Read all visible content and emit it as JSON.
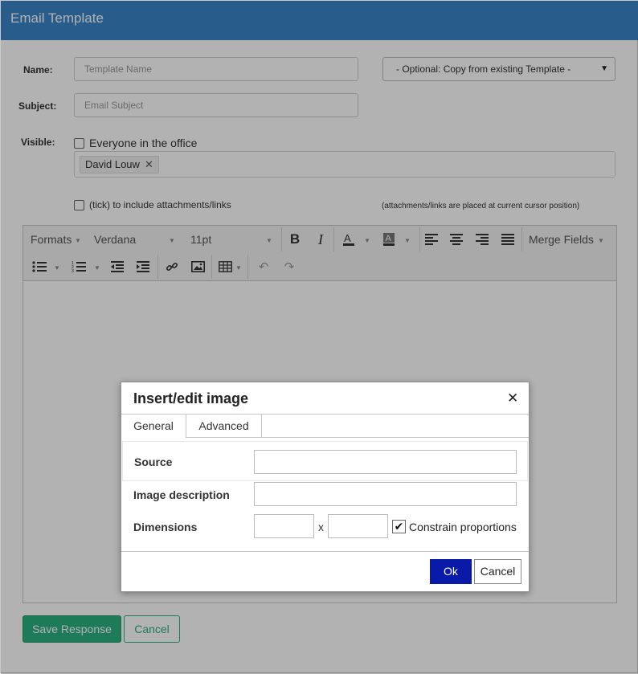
{
  "header": {
    "title": "Email Template"
  },
  "form": {
    "name_label": "Name:",
    "name_placeholder": "Template Name",
    "copy_select_value": "- Optional: Copy from existing Template -",
    "subject_label": "Subject:",
    "subject_placeholder": "Email Subject",
    "visible_label": "Visible:",
    "everyone_label": "Everyone in the office",
    "tag_user": "David Louw",
    "attach_label": "(tick) to include attachments/links",
    "attach_note": "(attachments/links are placed at current cursor position)"
  },
  "toolbar": {
    "formats": "Formats",
    "font": "Verdana",
    "size": "11pt",
    "merge_fields": "Merge Fields",
    "icons": [
      "bold-icon",
      "italic-icon",
      "font-color-icon",
      "background-color-icon",
      "align-left-icon",
      "align-center-icon",
      "align-right-icon",
      "justify-icon",
      "bullet-list-icon",
      "numbered-list-icon",
      "outdent-icon",
      "indent-icon",
      "link-icon",
      "image-icon",
      "table-icon",
      "undo-icon",
      "redo-icon"
    ]
  },
  "buttons": {
    "save": "Save Response",
    "cancel": "Cancel"
  },
  "dialog": {
    "title": "Insert/edit image",
    "tabs": [
      "General",
      "Advanced"
    ],
    "source_label": "Source",
    "description_label": "Image description",
    "dimensions_label": "Dimensions",
    "dimension_separator": "x",
    "constrain_label": "Constrain proportions",
    "constrain_checked": true,
    "ok": "Ok",
    "cancel": "Cancel"
  },
  "colors": {
    "header": "#3a84c6",
    "save_button": "#2bb07f",
    "ok_button": "#0a1aa8"
  }
}
